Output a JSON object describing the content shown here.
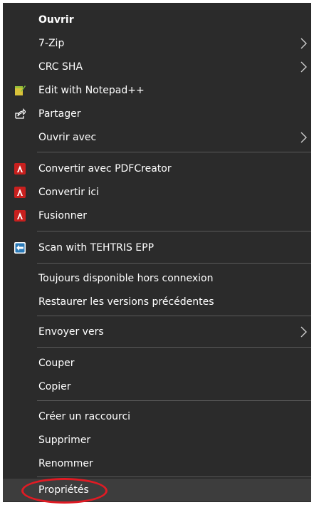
{
  "menu": {
    "items": [
      {
        "label": "Ouvrir"
      },
      {
        "label": "7-Zip"
      },
      {
        "label": "CRC SHA"
      },
      {
        "label": "Edit with Notepad++"
      },
      {
        "label": "Partager"
      },
      {
        "label": "Ouvrir avec"
      },
      {
        "label": "Convertir avec PDFCreator"
      },
      {
        "label": "Convertir ici"
      },
      {
        "label": "Fusionner"
      },
      {
        "label": "Scan with TEHTRIS EPP"
      },
      {
        "label": "Toujours disponible hors connexion"
      },
      {
        "label": "Restaurer les versions précédentes"
      },
      {
        "label": "Envoyer vers"
      },
      {
        "label": "Couper"
      },
      {
        "label": "Copier"
      },
      {
        "label": "Créer un raccourci"
      },
      {
        "label": "Supprimer"
      },
      {
        "label": "Renommer"
      },
      {
        "label": "Propriétés"
      }
    ]
  },
  "colors": {
    "menu_background": "#2b2b2b",
    "hover_background": "#3d3d3d",
    "separator": "#5a5a5a",
    "annotation_ring": "#e01b24",
    "pdfcreator_icon": "#c8201e",
    "tehtris_icon": "#2a7ab8",
    "notepad_icon": "#d9c23a"
  }
}
